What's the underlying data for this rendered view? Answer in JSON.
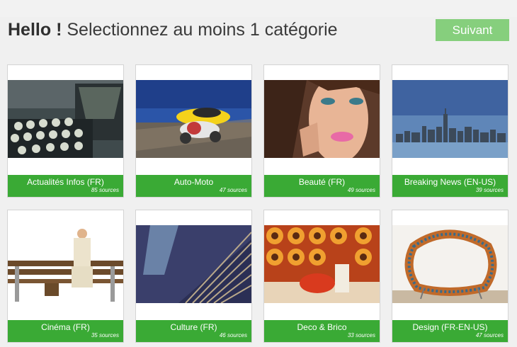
{
  "header": {
    "greeting": "Hello !",
    "title": "Selectionnez au moins 1 catégorie",
    "next_label": "Suivant",
    "next_color": "#86cf7d"
  },
  "accent_color": "#3aaa35",
  "categories": [
    {
      "name": "Actualités Infos (FR)",
      "sources": "85 sources",
      "image": "typewriter"
    },
    {
      "name": "Auto-Moto",
      "sources": "47 sources",
      "image": "car-and-motorcycle"
    },
    {
      "name": "Beauté (FR)",
      "sources": "49 sources",
      "image": "woman-face"
    },
    {
      "name": "Breaking News (EN-US)",
      "sources": "39 sources",
      "image": "city-skyline"
    },
    {
      "name": "Cinéma (FR)",
      "sources": "35 sources",
      "image": "man-on-bench"
    },
    {
      "name": "Culture (FR)",
      "sources": "46 sources",
      "image": "architecture"
    },
    {
      "name": "Deco & Brico",
      "sources": "33 sources",
      "image": "retro-interior"
    },
    {
      "name": "Design (FR-EN-US)",
      "sources": "47 sources",
      "image": "bookshelf-chair"
    }
  ]
}
